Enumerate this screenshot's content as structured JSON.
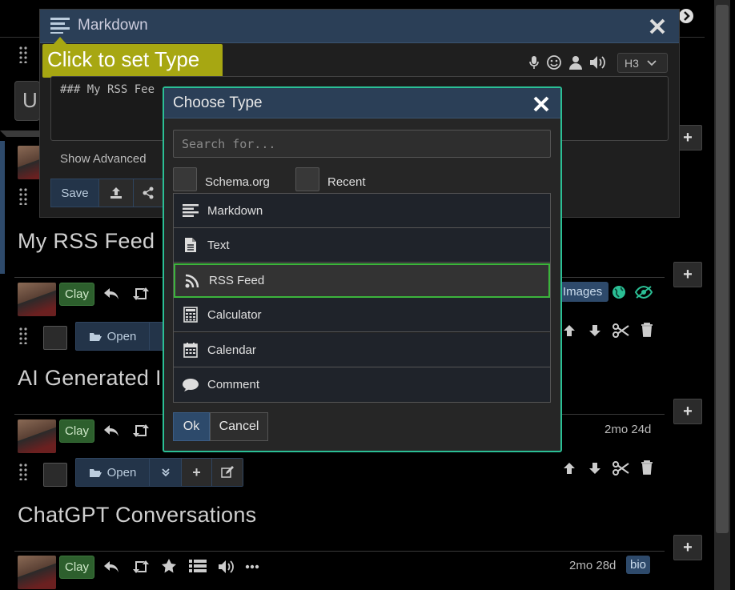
{
  "page": {
    "nodes": [
      {
        "title": "My RSS Feed",
        "user": "Clay",
        "extra_badge": "Images"
      },
      {
        "title": "AI Generated I",
        "user": "Clay",
        "timestamp": "2mo 24d"
      },
      {
        "title": "ChatGPT Conversations",
        "user": "Clay",
        "timestamp": "2mo 28d",
        "badge": "bio"
      }
    ],
    "open_label": "Open",
    "partial_u": "U"
  },
  "editor": {
    "title": "Markdown",
    "tooltip": "Click to set Type",
    "heading_select": "H3",
    "content": "### My RSS Fee",
    "show_advanced": "Show Advanced",
    "save_label": "Save"
  },
  "choose_type": {
    "title": "Choose Type",
    "search_placeholder": "Search for...",
    "schema_label": "Schema.org",
    "recent_label": "Recent",
    "items": [
      {
        "label": "Markdown",
        "icon": "align-left-icon"
      },
      {
        "label": "Text",
        "icon": "file-text-icon"
      },
      {
        "label": "RSS Feed",
        "icon": "rss-icon",
        "selected": true
      },
      {
        "label": "Calculator",
        "icon": "calculator-icon"
      },
      {
        "label": "Calendar",
        "icon": "calendar-icon"
      },
      {
        "label": "Comment",
        "icon": "comment-icon"
      }
    ],
    "ok_label": "Ok",
    "cancel_label": "Cancel"
  },
  "colors": {
    "accent_border": "#2bbf95",
    "selected_border": "#3cb43c",
    "header_bg": "#2b3f57",
    "tooltip_bg": "#a7a712",
    "user_badge": "#2d5f2d"
  }
}
